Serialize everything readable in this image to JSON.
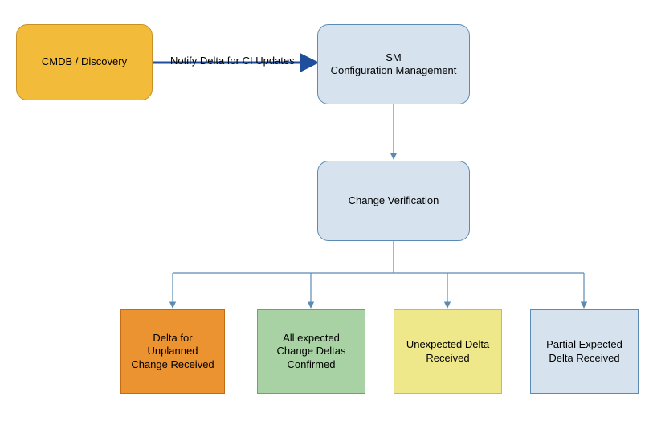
{
  "nodes": {
    "cmdb": "CMDB / Discovery",
    "smcm_line1": "SM",
    "smcm_line2": "Configuration Management",
    "cv": "Change Verification",
    "out1_line1": "Delta for",
    "out1_line2": "Unplanned",
    "out1_line3": "Change Received",
    "out2_line1": "All expected",
    "out2_line2": "Change Deltas",
    "out2_line3": "Confirmed",
    "out3_line1": "Unexpected Delta",
    "out3_line2": "Received",
    "out4_line1": "Partial Expected",
    "out4_line2": "Delta Received"
  },
  "edges": {
    "notify": "Notify Delta for CI Updates"
  },
  "chart_data": {
    "type": "flowchart",
    "nodes": [
      {
        "id": "cmdb",
        "label": "CMDB / Discovery",
        "shape": "rounded",
        "fill": "#f3bb3a"
      },
      {
        "id": "smcm",
        "label": "SM Configuration Management",
        "shape": "rounded",
        "fill": "#d6e3ee"
      },
      {
        "id": "cv",
        "label": "Change Verification",
        "shape": "rounded",
        "fill": "#d6e3ee"
      },
      {
        "id": "o1",
        "label": "Delta for Unplanned Change Received",
        "shape": "rect",
        "fill": "#ec9331"
      },
      {
        "id": "o2",
        "label": "All expected Change Deltas Confirmed",
        "shape": "rect",
        "fill": "#a8d2a4"
      },
      {
        "id": "o3",
        "label": "Unexpected Delta Received",
        "shape": "rect",
        "fill": "#efe88a"
      },
      {
        "id": "o4",
        "label": "Partial Expected Delta Received",
        "shape": "rect",
        "fill": "#d6e3ee"
      }
    ],
    "edges": [
      {
        "from": "cmdb",
        "to": "smcm",
        "label": "Notify Delta for CI Updates"
      },
      {
        "from": "smcm",
        "to": "cv"
      },
      {
        "from": "cv",
        "to": "o1"
      },
      {
        "from": "cv",
        "to": "o2"
      },
      {
        "from": "cv",
        "to": "o3"
      },
      {
        "from": "cv",
        "to": "o4"
      }
    ]
  }
}
